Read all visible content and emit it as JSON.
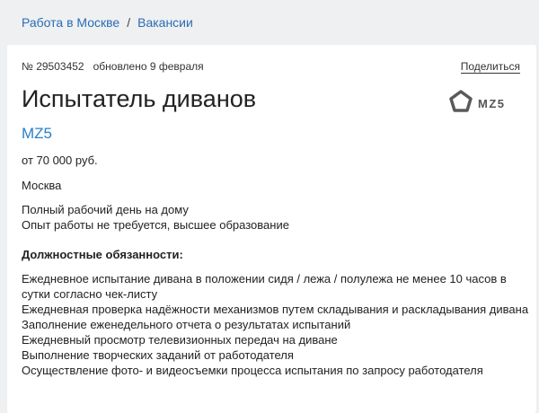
{
  "breadcrumb": {
    "items": [
      "Работа в Москве",
      "Вакансии"
    ],
    "separator": "/"
  },
  "vacancy": {
    "number": "№ 29503452",
    "updated": "обновлено 9 февраля",
    "share_label": "Поделиться",
    "title": "Испытатель диванов",
    "company": "MZ5",
    "logo_text": "MZ5",
    "salary": "от 70 000 руб.",
    "city": "Москва",
    "conditions": [
      "Полный рабочий день на дому",
      "Опыт работы не требуется, высшее образование"
    ],
    "duties_title": "Должностные обязанности:",
    "duties": [
      "Ежедневное испытание дивана в положении сидя / лежа / полулежа не менее 10 часов в сутки согласно чек-листу",
      "Ежедневная проверка надёжности механизмов путем складывания и раскладывания дивана",
      "Заполнение еженедельного отчета о результатах испытаний",
      "Ежедневный просмотр телевизионных передач на диване",
      "Выполнение творческих заданий от работодателя",
      "Осуществление фото- и видеосъемки процесса испытания по запросу работодателя"
    ]
  },
  "colors": {
    "link": "#2b6cb5",
    "company": "#2b7fc9",
    "background": "#eef0f1",
    "card": "#ffffff"
  }
}
